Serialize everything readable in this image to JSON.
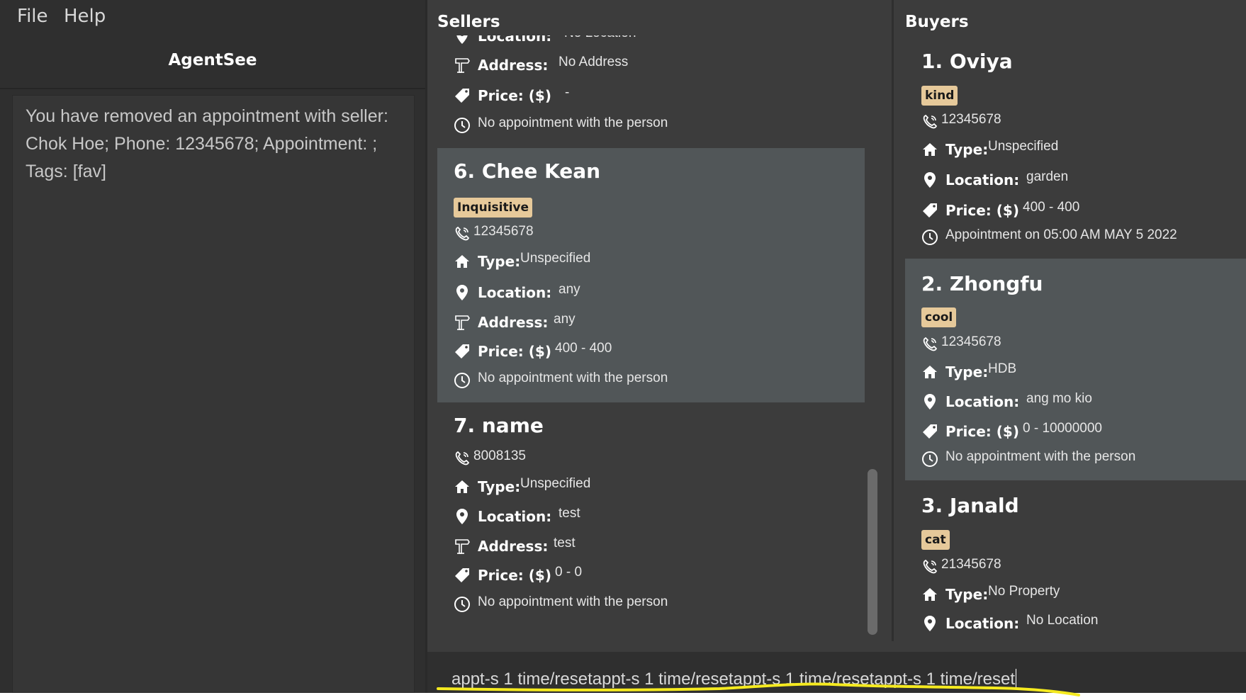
{
  "menu": {
    "file": "File",
    "help": "Help"
  },
  "app_title": "AgentSee",
  "result": {
    "line1": "You have removed an appointment with seller:",
    "line2": "Chok Hoe; Phone: 12345678; Appointment: ;",
    "line3": "Tags: [fav]"
  },
  "sellers": {
    "header": "Sellers",
    "partial": {
      "location_label": "Location:",
      "location_value": "No Location",
      "address_label": "Address:",
      "address_value": "No Address",
      "price_label": "Price: ($)",
      "price_value": "-",
      "appointment": "No appointment with the person"
    },
    "cards": [
      {
        "name": "6.  Chee Kean",
        "tag": "Inquisitive",
        "phone": "12345678",
        "type_label": "Type:",
        "type_value": "Unspecified",
        "location_label": "Location:",
        "location_value": "any",
        "address_label": "Address:",
        "address_value": "any",
        "price_label": "Price: ($)",
        "price_value": "400 - 400",
        "appointment": "No appointment with the person"
      },
      {
        "name": "7.  name",
        "phone": "8008135",
        "type_label": "Type:",
        "type_value": "Unspecified",
        "location_label": "Location:",
        "location_value": "test",
        "address_label": "Address:",
        "address_value": "test",
        "price_label": "Price: ($)",
        "price_value": "0 - 0",
        "appointment": "No appointment with the person"
      }
    ]
  },
  "buyers": {
    "header": "Buyers",
    "cards": [
      {
        "name": "1.  Oviya",
        "tag": "kind",
        "phone": "12345678",
        "type_label": "Type:",
        "type_value": "Unspecified",
        "location_label": "Location:",
        "location_value": "garden",
        "price_label": "Price: ($)",
        "price_value": "400 - 400",
        "appointment": "Appointment on 05:00 AM MAY 5 2022"
      },
      {
        "name": "2.  Zhongfu",
        "tag": "cool",
        "phone": "12345678",
        "type_label": "Type:",
        "type_value": "HDB",
        "location_label": "Location:",
        "location_value": "ang mo kio",
        "price_label": "Price: ($)",
        "price_value": "0 - 10000000",
        "appointment": "No appointment with the person"
      },
      {
        "name": "3.  Janald",
        "tag": "cat",
        "phone": "21345678",
        "type_label": "Type:",
        "type_value": "No Property",
        "location_label": "Location:",
        "location_value": "No Location"
      }
    ]
  },
  "command": {
    "value": "appt-s 1 time/resetappt-s 1 time/resetappt-s 1 time/resetappt-s 1 time/reset"
  },
  "colors": {
    "background": "#3c3c3c",
    "panel": "#2f2f2f",
    "selected_card": "#515658",
    "tag": "#e6c99a",
    "highlight_annotation": "#f5ea1f"
  },
  "icons": [
    "phone-icon",
    "home-icon",
    "location-pin-icon",
    "signpost-icon",
    "price-tag-icon",
    "clock-icon"
  ]
}
